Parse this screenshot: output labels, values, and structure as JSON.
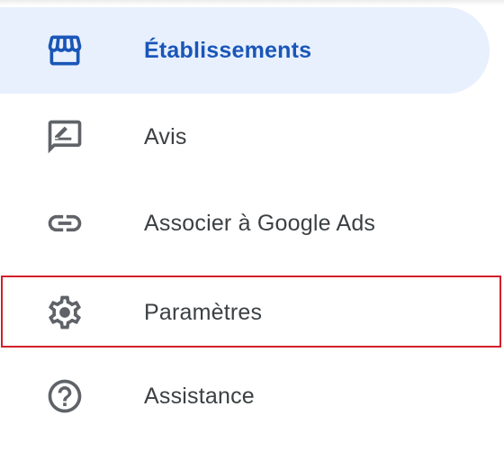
{
  "nav": {
    "items": [
      {
        "label": "Établissements",
        "icon": "storefront-icon",
        "active": true
      },
      {
        "label": "Avis",
        "icon": "rate-review-icon",
        "active": false
      },
      {
        "label": "Associer à Google Ads",
        "icon": "link-icon",
        "active": false
      },
      {
        "label": "Paramètres",
        "icon": "gear-icon",
        "active": false,
        "highlighted": true
      },
      {
        "label": "Assistance",
        "icon": "help-circle-icon",
        "active": false
      }
    ]
  },
  "colors": {
    "active_bg": "#e8f0fe",
    "active_text": "#1a56b8",
    "text": "#3c4043",
    "icon": "#5f6368",
    "highlight_border": "#d21f2a"
  }
}
